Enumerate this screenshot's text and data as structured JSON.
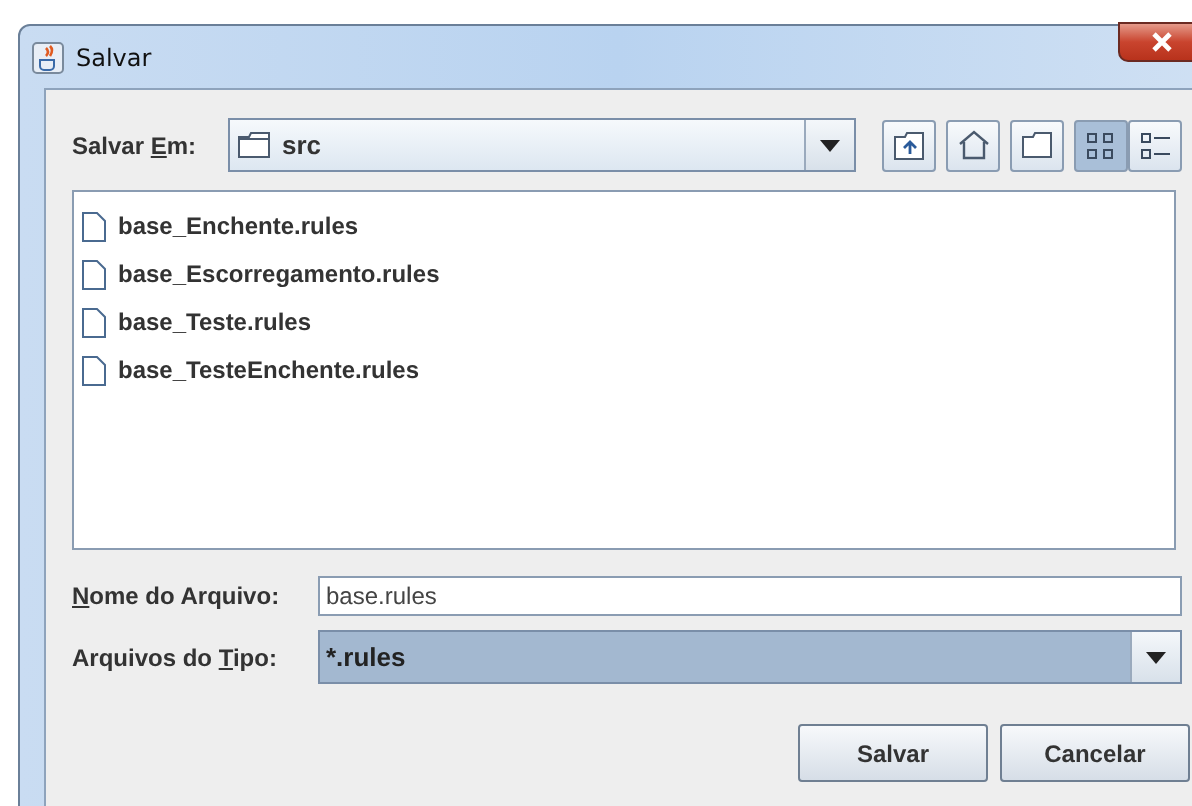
{
  "window": {
    "title": "Salvar"
  },
  "location": {
    "label_start": "Salvar ",
    "mnemonic": "E",
    "label_end": "m:",
    "value": "src"
  },
  "toolbar": [
    {
      "kind": "up",
      "selected": false
    },
    {
      "kind": "home",
      "selected": false
    },
    {
      "kind": "new-folder",
      "selected": false
    },
    {
      "kind": "list",
      "selected": true
    },
    {
      "kind": "details",
      "selected": false
    }
  ],
  "files": [
    {
      "name": "base_Enchente.rules"
    },
    {
      "name": "base_Escorregamento.rules"
    },
    {
      "name": "base_Teste.rules"
    },
    {
      "name": "base_TesteEnchente.rules"
    }
  ],
  "file_name": {
    "mnemonic": "N",
    "label_end": "ome do Arquivo:",
    "value": "base.rules"
  },
  "file_type": {
    "label_start": "Arquivos do ",
    "mnemonic": "T",
    "label_end": "ipo:",
    "value": "*.rules",
    "highlighted": true
  },
  "buttons": [
    {
      "label": "Salvar"
    },
    {
      "label": "Cancelar"
    }
  ]
}
